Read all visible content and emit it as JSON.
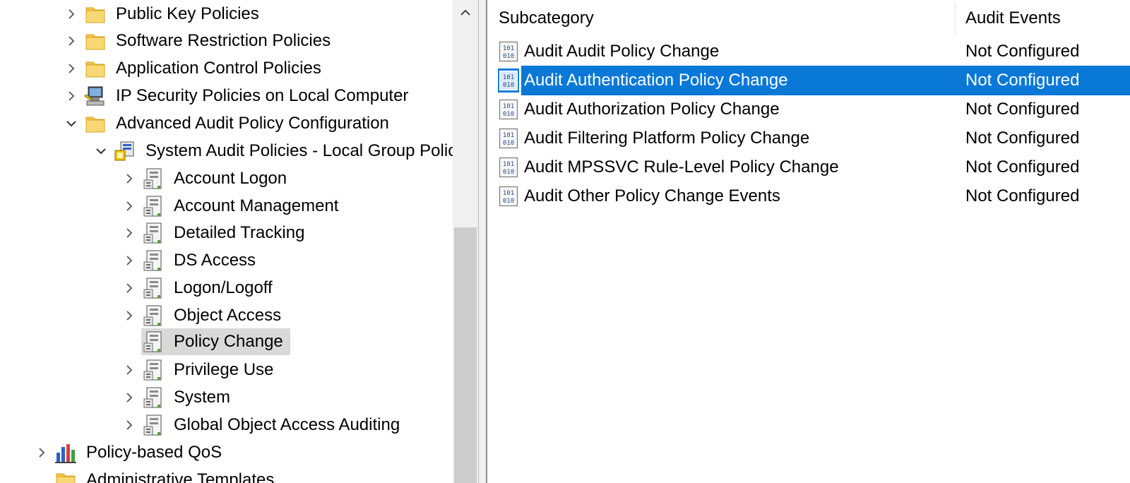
{
  "tree": {
    "items": [
      {
        "label": "Public Key Policies",
        "icon": "folder-icon",
        "expander": "collapsed"
      },
      {
        "label": "Software Restriction Policies",
        "icon": "folder-icon",
        "expander": "collapsed"
      },
      {
        "label": "Application Control Policies",
        "icon": "folder-icon",
        "expander": "collapsed"
      },
      {
        "label": "IP Security Policies on Local Computer",
        "icon": "ip-security-icon",
        "expander": "collapsed"
      },
      {
        "label": "Advanced Audit Policy Configuration",
        "icon": "folder-icon",
        "expander": "expanded"
      },
      {
        "label": "System Audit Policies - Local Group Policy Object",
        "icon": "audit-policies-icon",
        "expander": "expanded"
      },
      {
        "label": "Account Logon",
        "icon": "audit-category-icon",
        "expander": "collapsed"
      },
      {
        "label": "Account Management",
        "icon": "audit-category-icon",
        "expander": "collapsed"
      },
      {
        "label": "Detailed Tracking",
        "icon": "audit-category-icon",
        "expander": "collapsed"
      },
      {
        "label": "DS Access",
        "icon": "audit-category-icon",
        "expander": "collapsed"
      },
      {
        "label": "Logon/Logoff",
        "icon": "audit-category-icon",
        "expander": "collapsed"
      },
      {
        "label": "Object Access",
        "icon": "audit-category-icon",
        "expander": "collapsed"
      },
      {
        "label": "Policy Change",
        "icon": "audit-category-icon",
        "expander": "none",
        "selected": true
      },
      {
        "label": "Privilege Use",
        "icon": "audit-category-icon",
        "expander": "collapsed"
      },
      {
        "label": "System",
        "icon": "audit-category-icon",
        "expander": "collapsed"
      },
      {
        "label": "Global Object Access Auditing",
        "icon": "audit-category-icon",
        "expander": "collapsed"
      },
      {
        "label": "Policy-based QoS",
        "icon": "bar-chart-icon",
        "expander": "collapsed"
      },
      {
        "label": "Administrative Templates",
        "icon": "folder-icon",
        "expander": "collapsed"
      }
    ]
  },
  "list": {
    "columns": {
      "subcategory": "Subcategory",
      "audit_events": "Audit Events"
    },
    "rows": [
      {
        "name": "Audit Audit Policy Change",
        "status": "Not Configured"
      },
      {
        "name": "Audit Authentication Policy Change",
        "status": "Not Configured",
        "selected": true
      },
      {
        "name": "Audit Authorization Policy Change",
        "status": "Not Configured"
      },
      {
        "name": "Audit Filtering Platform Policy Change",
        "status": "Not Configured"
      },
      {
        "name": "Audit MPSSVC Rule-Level Policy Change",
        "status": "Not Configured"
      },
      {
        "name": "Audit Other Policy Change Events",
        "status": "Not Configured"
      }
    ]
  },
  "colors": {
    "selection_blue": "#0a78d7",
    "tree_selection_gray": "#d9d9d9",
    "folder_yellow": "#f5c34a"
  }
}
